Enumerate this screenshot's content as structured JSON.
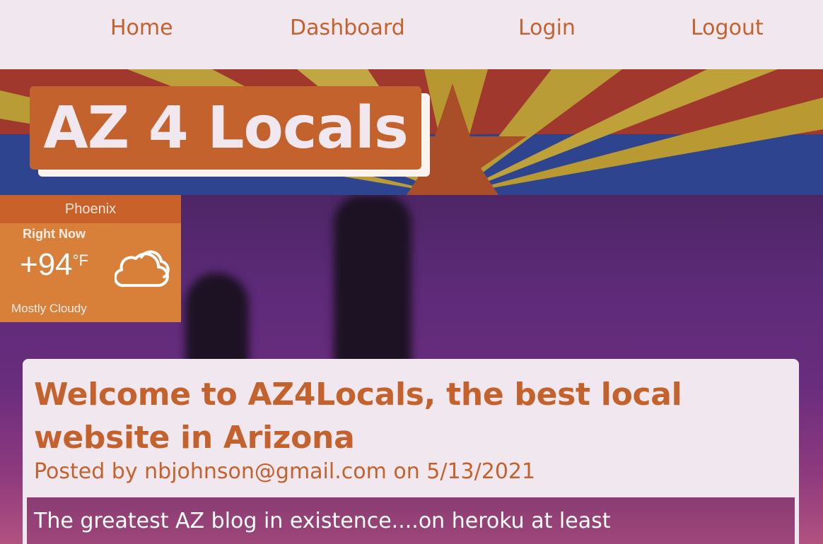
{
  "nav": {
    "items": [
      {
        "label": "Home"
      },
      {
        "label": "Dashboard"
      },
      {
        "label": "Login"
      },
      {
        "label": "Logout"
      }
    ]
  },
  "brand": {
    "title": "AZ 4 Locals"
  },
  "weather": {
    "city": "Phoenix",
    "period": "Right Now",
    "temperature": "+94",
    "unit": "°F",
    "condition": "Mostly Cloudy",
    "icon": "cloud-icon"
  },
  "post": {
    "title": "Welcome to AZ4Locals, the best local website in Arizona",
    "meta": "Posted by nbjohnson@gmail.com on 5/13/2021",
    "body": "The greatest AZ blog in existence....on heroku at least"
  },
  "colors": {
    "accent": "#c4622d",
    "nav_background": "#f1e7ef",
    "weather_background": "#d8803a"
  }
}
